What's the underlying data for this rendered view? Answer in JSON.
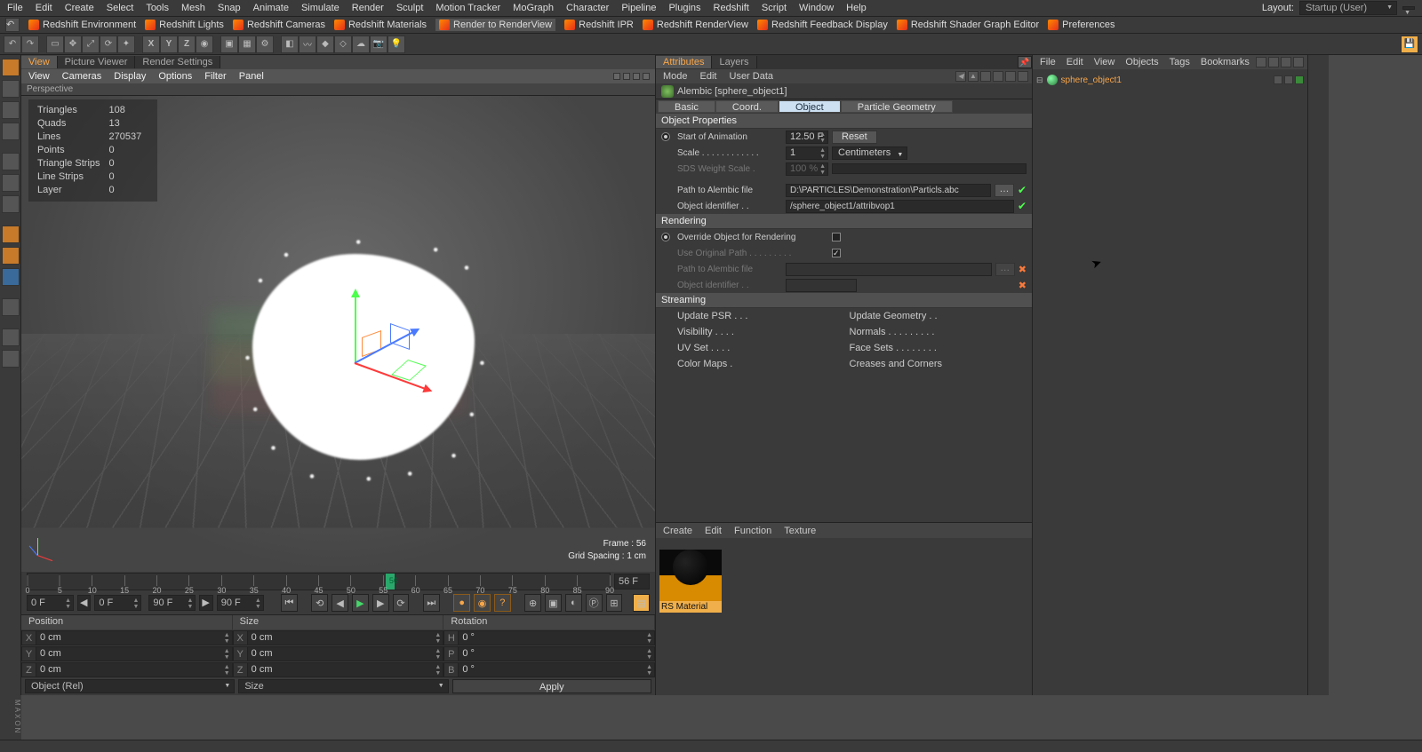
{
  "layout_label": "Layout:",
  "layout_value": "Startup (User)",
  "menubar": [
    "File",
    "Edit",
    "Create",
    "Select",
    "Tools",
    "Mesh",
    "Snap",
    "Animate",
    "Simulate",
    "Render",
    "Sculpt",
    "Motion Tracker",
    "MoGraph",
    "Character",
    "Pipeline",
    "Plugins",
    "Redshift",
    "Script",
    "Window",
    "Help"
  ],
  "shelf": [
    "Redshift Environment",
    "Redshift Lights",
    "Redshift Cameras",
    "Redshift Materials",
    "Render to RenderView",
    "Redshift IPR",
    "Redshift RenderView",
    "Redshift Feedback Display",
    "Redshift Shader Graph Editor",
    "Preferences"
  ],
  "shelf_active": 4,
  "view_tabs": [
    "View",
    "Picture Viewer",
    "Render Settings"
  ],
  "view_menu": [
    "View",
    "Cameras",
    "Display",
    "Options",
    "Filter",
    "Panel"
  ],
  "view_label": "Perspective",
  "hud": {
    "Triangles": "108",
    "Quads": "13",
    "Lines": "270537",
    "Points": "0",
    "Triangle Strips": "0",
    "Line Strips": "0",
    "Layer": "0"
  },
  "frame_label": "Frame : 56",
  "grid_label": "Grid Spacing : 1 cm",
  "timeline": {
    "ticks": [
      "0",
      "5",
      "10",
      "15",
      "20",
      "25",
      "30",
      "35",
      "40",
      "45",
      "50",
      "55",
      "60",
      "65",
      "70",
      "75",
      "80",
      "85",
      "90"
    ],
    "playhead_tick": "56",
    "frame_field": "56 F",
    "f0": "0 F",
    "fstart": "0 F",
    "fend": "90 F",
    "fend2": "90 F"
  },
  "coord": {
    "hdrs": [
      "Position",
      "Size",
      "Rotation"
    ],
    "rows": [
      {
        "a": "X",
        "v1": "0 cm",
        "b": "X",
        "v2": "0 cm",
        "c": "H",
        "v3": "0 °"
      },
      {
        "a": "Y",
        "v1": "0 cm",
        "b": "Y",
        "v2": "0 cm",
        "c": "P",
        "v3": "0 °"
      },
      {
        "a": "Z",
        "v1": "0 cm",
        "b": "Z",
        "v2": "0 cm",
        "c": "B",
        "v3": "0 °"
      }
    ],
    "dd1": "Object (Rel)",
    "dd2": "Size",
    "apply": "Apply"
  },
  "attr": {
    "tabs": [
      "Attributes",
      "Layers"
    ],
    "menu": [
      "Mode",
      "Edit",
      "User Data"
    ],
    "title": "Alembic [sphere_object1]",
    "subtabs": [
      "Basic",
      "Coord.",
      "Object",
      "Particle Geometry"
    ],
    "sections": {
      "obj": "Object Properties",
      "render": "Rendering",
      "stream": "Streaming"
    },
    "start_lbl": "Start of Animation",
    "start_val": "12.50 F",
    "reset": "Reset",
    "scale_lbl": "Scale . . . . . . . . . . . .",
    "scale_val": "1",
    "unit": "Centimeters",
    "sds_lbl": "SDS Weight Scale .",
    "sds_val": "100 %",
    "path_lbl": "Path to Alembic file",
    "path_val": "D:\\PARTICLES\\Demonstration\\Particls.abc",
    "objid_lbl": "Object identifier  . .",
    "objid_val": "/sphere_object1/attribvop1",
    "override_lbl": "Override Object for Rendering",
    "useorig_lbl": "Use Original Path  . . . . . . . . .",
    "path2_lbl": "Path to Alembic file",
    "objid2_lbl": "Object identifier  . .",
    "upd_psr": "Update PSR . . .",
    "upd_geo": "Update Geometry . .",
    "vis": "Visibility . . . .",
    "norm": "Normals  . . . . . . . . .",
    "uvset": "UV Set  . . . .",
    "faceset": "Face Sets  . . . . . . . .",
    "cmap": "Color Maps .",
    "crease": "Creases and Corners"
  },
  "matmenu": [
    "Create",
    "Edit",
    "Function",
    "Texture"
  ],
  "material_name": "RS Material",
  "objmgr_menu": [
    "File",
    "Edit",
    "View",
    "Objects",
    "Tags",
    "Bookmarks"
  ],
  "tree_item": "sphere_object1"
}
